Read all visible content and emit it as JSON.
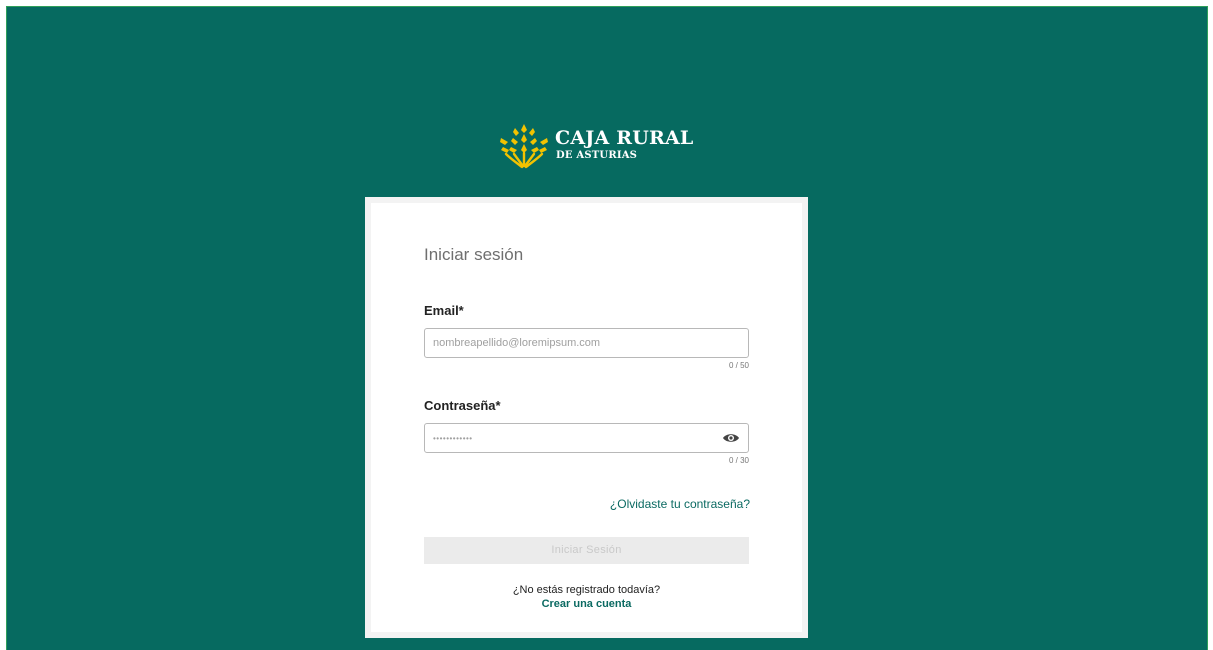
{
  "brand": {
    "line1": "CAJA RURAL",
    "line2": "DE ASTURIAS",
    "icon": "wheat-logo-icon",
    "color_logo": "#f2c200",
    "color_background": "#066a60"
  },
  "login": {
    "title": "Iniciar sesión",
    "email": {
      "label": "Email*",
      "placeholder": "nombreapellido@loremipsum.com",
      "value": "",
      "counter": "0 / 50"
    },
    "password": {
      "label": "Contraseña*",
      "placeholder": "••••••••••••",
      "value": "",
      "counter": "0 / 30",
      "toggle_icon": "eye-icon"
    },
    "forgot_link": "¿Olvidaste tu contraseña?",
    "submit_label": "Iniciar Sesión",
    "submit_enabled": false,
    "register_question": "¿No estás registrado todavía?",
    "register_link": "Crear una cuenta",
    "accent_color": "#0b6a62"
  }
}
